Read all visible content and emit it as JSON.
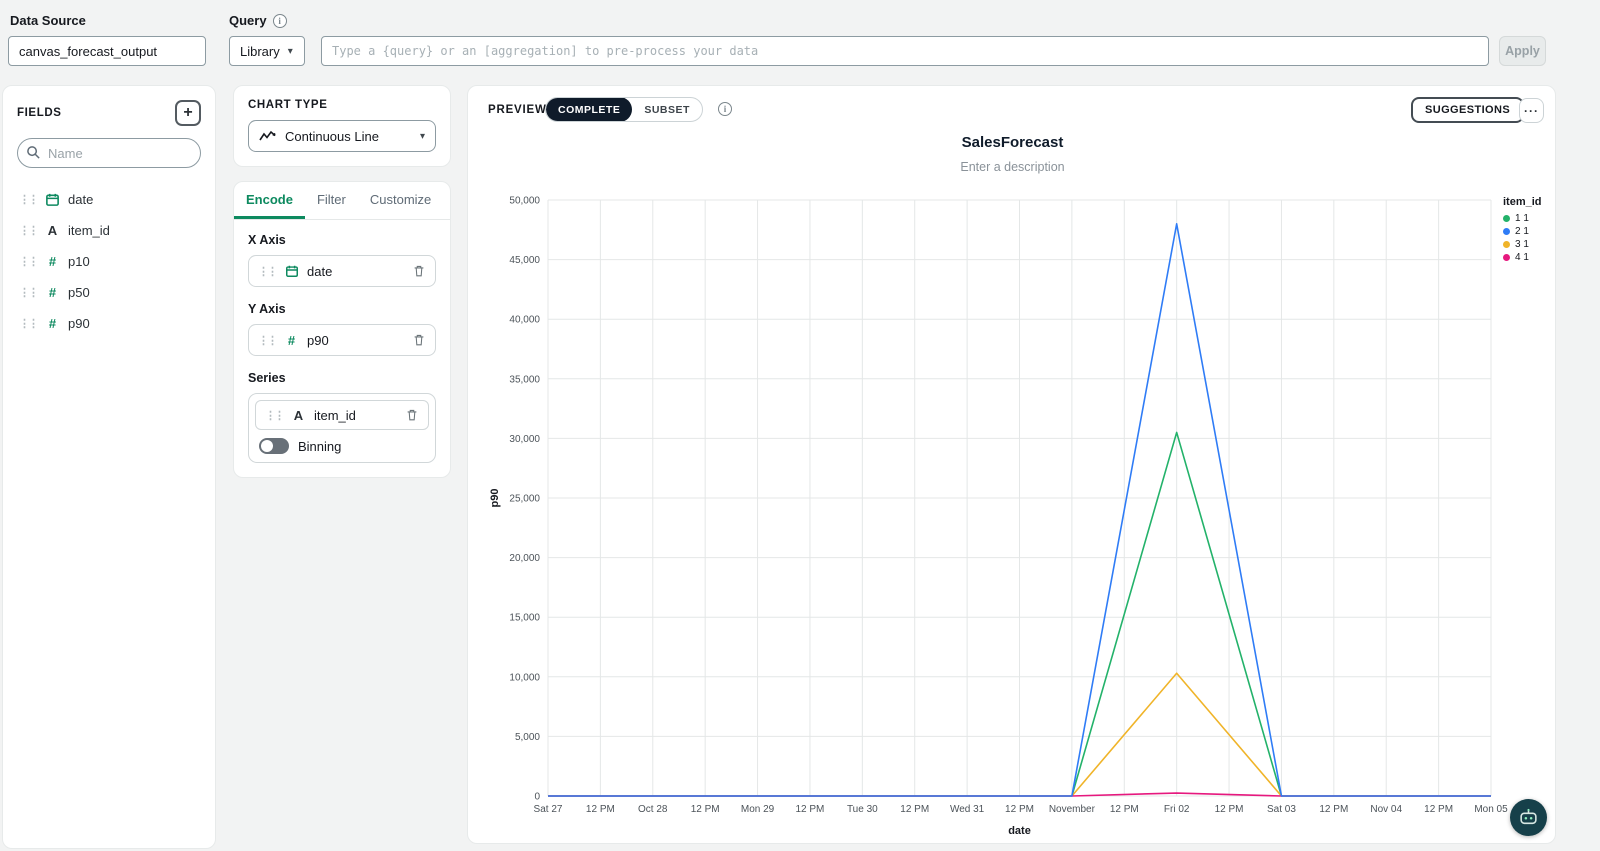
{
  "topbar": {
    "data_source_label": "Data Source",
    "data_source_value": "canvas_forecast_output",
    "query_label": "Query",
    "library_label": "Library",
    "query_placeholder": "Type a {query} or an [aggregation] to pre-process your data",
    "apply_label": "Apply"
  },
  "fields_panel": {
    "title": "FIELDS",
    "add_label": "+",
    "search_placeholder": "Name",
    "items": [
      {
        "name": "date",
        "type": "date"
      },
      {
        "name": "item_id",
        "type": "text"
      },
      {
        "name": "p10",
        "type": "number"
      },
      {
        "name": "p50",
        "type": "number"
      },
      {
        "name": "p90",
        "type": "number"
      }
    ]
  },
  "chart_panel": {
    "chart_type_label": "CHART TYPE",
    "chart_type_value": "Continuous Line",
    "tabs": [
      {
        "label": "Encode"
      },
      {
        "label": "Filter"
      },
      {
        "label": "Customize"
      }
    ],
    "x_axis_label": "X Axis",
    "x_axis_field": "date",
    "y_axis_label": "Y Axis",
    "y_axis_field": "p90",
    "series_label": "Series",
    "series_field": "item_id",
    "binning_label": "Binning"
  },
  "preview": {
    "label": "PREVIEW",
    "complete_label": "COMPLETE",
    "subset_label": "SUBSET",
    "suggestions_label": "SUGGESTIONS",
    "more_label": "···"
  },
  "chart_data": {
    "type": "line",
    "title": "SalesForecast",
    "subtitle": "Enter a description",
    "xlabel": "date",
    "ylabel": "p90",
    "ylim": [
      0,
      50000
    ],
    "ytick_step": 5000,
    "grid": true,
    "legend_position": "right",
    "legend_title": "item_id",
    "x_tick_labels": [
      "Sat 27",
      "12 PM",
      "Oct 28",
      "12 PM",
      "Mon 29",
      "12 PM",
      "Tue 30",
      "12 PM",
      "Wed 31",
      "12 PM",
      "November",
      "12 PM",
      "Fri 02",
      "12 PM",
      "Sat 03",
      "12 PM",
      "Nov 04",
      "12 PM",
      "Mon 05"
    ],
    "draw_order": [
      0,
      2,
      3,
      1
    ],
    "series": [
      {
        "name": "1 1",
        "color": "#23b26a",
        "points": [
          [
            0,
            0
          ],
          [
            2,
            0
          ],
          [
            4,
            0
          ],
          [
            6,
            0
          ],
          [
            8,
            0
          ],
          [
            10,
            0
          ],
          [
            12,
            30500
          ],
          [
            14,
            0
          ],
          [
            16,
            0
          ],
          [
            18,
            0
          ]
        ]
      },
      {
        "name": "2 1",
        "color": "#2f7cf6",
        "points": [
          [
            0,
            0
          ],
          [
            2,
            0
          ],
          [
            4,
            0
          ],
          [
            6,
            0
          ],
          [
            8,
            0
          ],
          [
            10,
            0
          ],
          [
            12,
            48000
          ],
          [
            14,
            0
          ],
          [
            16,
            0
          ],
          [
            18,
            0
          ]
        ]
      },
      {
        "name": "3 1",
        "color": "#f0b429",
        "points": [
          [
            0,
            0
          ],
          [
            2,
            0
          ],
          [
            4,
            0
          ],
          [
            6,
            0
          ],
          [
            8,
            0
          ],
          [
            10,
            0
          ],
          [
            12,
            10300
          ],
          [
            14,
            0
          ],
          [
            16,
            0
          ],
          [
            18,
            0
          ]
        ]
      },
      {
        "name": "4 1",
        "color": "#e6187e",
        "points": [
          [
            0,
            0
          ],
          [
            2,
            0
          ],
          [
            4,
            0
          ],
          [
            6,
            0
          ],
          [
            8,
            0
          ],
          [
            10,
            0
          ],
          [
            12,
            250
          ],
          [
            14,
            0
          ],
          [
            16,
            0
          ],
          [
            18,
            0
          ]
        ]
      }
    ]
  }
}
